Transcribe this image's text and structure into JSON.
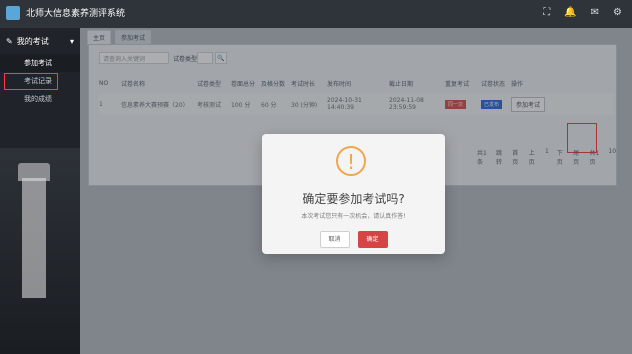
{
  "app": {
    "brand": "北师大信息素养测评系统"
  },
  "sidebar": {
    "section": "我的考试",
    "items": [
      {
        "label": "参加考试"
      },
      {
        "label": "考试记录"
      },
      {
        "label": "我的成绩"
      }
    ]
  },
  "tabs": [
    {
      "label": "主页"
    },
    {
      "label": "参加考试"
    }
  ],
  "search": {
    "placeholder": "请查询入关键词",
    "type_label": "试卷类型"
  },
  "table": {
    "headers": [
      "NO",
      "试卷名称",
      "试卷类型",
      "卷面总分",
      "及格分数",
      "考试时长",
      "发布时间",
      "截止日期",
      "重复考试",
      "试卷状态",
      "操作"
    ],
    "rows": [
      {
        "no": "1",
        "name": "信息素养大赛预赛（20）",
        "type": "考核测试",
        "total": "100 分",
        "pass": "60 分",
        "duration": "30 (分钟)",
        "publish": "2024-10-31 14:40:39",
        "deadline": "2024-11-08 23:59:59",
        "repeat": "同一次",
        "status": "已发布",
        "action": "参加考试"
      }
    ]
  },
  "pagination": {
    "total": "共1条",
    "jump": "跳转",
    "first": "首页",
    "prev": "上页",
    "page": "1",
    "next": "下页",
    "last": "尾页",
    "count": "共1页",
    "size": "10"
  },
  "modal": {
    "title": "确定要参加考试吗?",
    "subtitle": "本次考试您只有一次机会，请认真作答!",
    "cancel": "取消",
    "confirm": "确定"
  }
}
